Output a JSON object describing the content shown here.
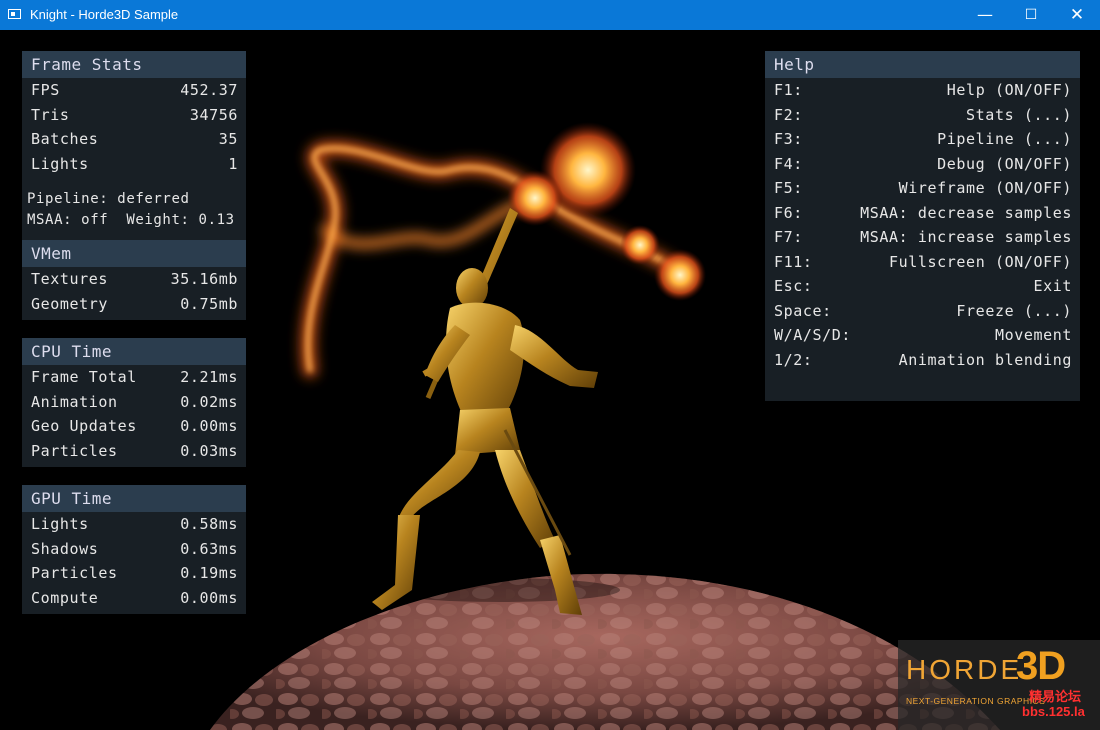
{
  "window": {
    "title": "Knight - Horde3D Sample",
    "minimize_glyph": "—",
    "maximize_glyph": "☐",
    "close_glyph": "✕"
  },
  "frame_stats": {
    "header": "Frame Stats",
    "rows": [
      {
        "label": "FPS",
        "value": "452.37"
      },
      {
        "label": "Tris",
        "value": "34756"
      },
      {
        "label": "Batches",
        "value": "35"
      },
      {
        "label": "Lights",
        "value": "1"
      }
    ],
    "pipeline_line": "Pipeline: deferred",
    "msaa_line": "MSAA: off  Weight: 0.13"
  },
  "vmem": {
    "header": "VMem",
    "rows": [
      {
        "label": "Textures",
        "value": "35.16mb"
      },
      {
        "label": "Geometry",
        "value": "0.75mb"
      }
    ]
  },
  "cpu_time": {
    "header": "CPU Time",
    "rows": [
      {
        "label": "Frame Total",
        "value": "2.21ms"
      },
      {
        "label": "Animation",
        "value": "0.02ms"
      },
      {
        "label": "Geo Updates",
        "value": "0.00ms"
      },
      {
        "label": "Particles",
        "value": "0.03ms"
      }
    ]
  },
  "gpu_time": {
    "header": "GPU Time",
    "rows": [
      {
        "label": "Lights",
        "value": "0.58ms"
      },
      {
        "label": "Shadows",
        "value": "0.63ms"
      },
      {
        "label": "Particles",
        "value": "0.19ms"
      },
      {
        "label": "Compute",
        "value": "0.00ms"
      }
    ]
  },
  "help": {
    "header": "Help",
    "rows": [
      {
        "key": "F1:",
        "action": "Help (ON/OFF)"
      },
      {
        "key": "F2:",
        "action": "Stats (...)"
      },
      {
        "key": "F3:",
        "action": "Pipeline (...)"
      },
      {
        "key": "F4:",
        "action": "Debug (ON/OFF)"
      },
      {
        "key": "F5:",
        "action": "Wireframe (ON/OFF)"
      },
      {
        "key": "F6:",
        "action": "MSAA: decrease samples"
      },
      {
        "key": "F7:",
        "action": "MSAA: increase samples"
      },
      {
        "key": "F11:",
        "action": "Fullscreen (ON/OFF)"
      },
      {
        "key": "Esc:",
        "action": "Exit"
      },
      {
        "key": "Space:",
        "action": "Freeze (...)"
      },
      {
        "key": "W/A/S/D:",
        "action": "Movement"
      },
      {
        "key": "1/2:",
        "action": "Animation blending"
      }
    ]
  },
  "logo": {
    "word": "HORDE",
    "accent": "3D",
    "tagline": "NEXT-GENERATION GRAPHICS",
    "watermark_cn": "精易论坛",
    "watermark_url": "bbs.125.la"
  },
  "colors": {
    "titlebar": "#0a78d7",
    "logo_orange": "#f0a535",
    "watermark_red": "#ff3030"
  }
}
